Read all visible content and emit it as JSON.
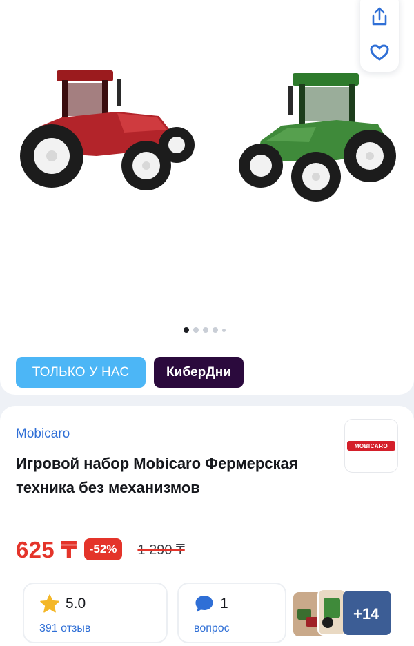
{
  "gallery": {
    "actions": {
      "share_icon": "share-icon",
      "favorite_icon": "heart-icon"
    },
    "image_count": 5,
    "active_index": 0
  },
  "badges": {
    "exclusive": "ТОЛЬКО У НАС",
    "promo": "КиберДни"
  },
  "product": {
    "brand": "Mobicaro",
    "brand_logo_text": "MOBICARO",
    "title": "Игровой набор Mobicaro Фермерская техника без механизмов",
    "price": "625 ₸",
    "discount": "-52%",
    "old_price": "1 290 ₸"
  },
  "stats": {
    "rating_value": "5.0",
    "reviews": "391 отзыв",
    "questions_count": "1",
    "questions_label": "вопрос"
  },
  "thumbs": {
    "more_label": "+14"
  },
  "colors": {
    "accent_blue": "#2f6fd6",
    "price_red": "#e4342a",
    "badge_sky": "#4cb6f6",
    "badge_dark": "#2b0a3d",
    "star": "#f4b728"
  }
}
